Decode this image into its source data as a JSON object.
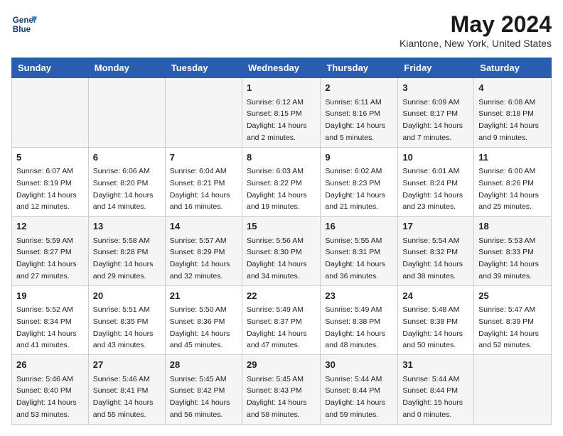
{
  "logo": {
    "line1": "General",
    "line2": "Blue"
  },
  "title": "May 2024",
  "location": "Kiantone, New York, United States",
  "days_header": [
    "Sunday",
    "Monday",
    "Tuesday",
    "Wednesday",
    "Thursday",
    "Friday",
    "Saturday"
  ],
  "weeks": [
    [
      {
        "day": "",
        "info": ""
      },
      {
        "day": "",
        "info": ""
      },
      {
        "day": "",
        "info": ""
      },
      {
        "day": "1",
        "info": "Sunrise: 6:12 AM\nSunset: 8:15 PM\nDaylight: 14 hours\nand 2 minutes."
      },
      {
        "day": "2",
        "info": "Sunrise: 6:11 AM\nSunset: 8:16 PM\nDaylight: 14 hours\nand 5 minutes."
      },
      {
        "day": "3",
        "info": "Sunrise: 6:09 AM\nSunset: 8:17 PM\nDaylight: 14 hours\nand 7 minutes."
      },
      {
        "day": "4",
        "info": "Sunrise: 6:08 AM\nSunset: 8:18 PM\nDaylight: 14 hours\nand 9 minutes."
      }
    ],
    [
      {
        "day": "5",
        "info": "Sunrise: 6:07 AM\nSunset: 8:19 PM\nDaylight: 14 hours\nand 12 minutes."
      },
      {
        "day": "6",
        "info": "Sunrise: 6:06 AM\nSunset: 8:20 PM\nDaylight: 14 hours\nand 14 minutes."
      },
      {
        "day": "7",
        "info": "Sunrise: 6:04 AM\nSunset: 8:21 PM\nDaylight: 14 hours\nand 16 minutes."
      },
      {
        "day": "8",
        "info": "Sunrise: 6:03 AM\nSunset: 8:22 PM\nDaylight: 14 hours\nand 19 minutes."
      },
      {
        "day": "9",
        "info": "Sunrise: 6:02 AM\nSunset: 8:23 PM\nDaylight: 14 hours\nand 21 minutes."
      },
      {
        "day": "10",
        "info": "Sunrise: 6:01 AM\nSunset: 8:24 PM\nDaylight: 14 hours\nand 23 minutes."
      },
      {
        "day": "11",
        "info": "Sunrise: 6:00 AM\nSunset: 8:26 PM\nDaylight: 14 hours\nand 25 minutes."
      }
    ],
    [
      {
        "day": "12",
        "info": "Sunrise: 5:59 AM\nSunset: 8:27 PM\nDaylight: 14 hours\nand 27 minutes."
      },
      {
        "day": "13",
        "info": "Sunrise: 5:58 AM\nSunset: 8:28 PM\nDaylight: 14 hours\nand 29 minutes."
      },
      {
        "day": "14",
        "info": "Sunrise: 5:57 AM\nSunset: 8:29 PM\nDaylight: 14 hours\nand 32 minutes."
      },
      {
        "day": "15",
        "info": "Sunrise: 5:56 AM\nSunset: 8:30 PM\nDaylight: 14 hours\nand 34 minutes."
      },
      {
        "day": "16",
        "info": "Sunrise: 5:55 AM\nSunset: 8:31 PM\nDaylight: 14 hours\nand 36 minutes."
      },
      {
        "day": "17",
        "info": "Sunrise: 5:54 AM\nSunset: 8:32 PM\nDaylight: 14 hours\nand 38 minutes."
      },
      {
        "day": "18",
        "info": "Sunrise: 5:53 AM\nSunset: 8:33 PM\nDaylight: 14 hours\nand 39 minutes."
      }
    ],
    [
      {
        "day": "19",
        "info": "Sunrise: 5:52 AM\nSunset: 8:34 PM\nDaylight: 14 hours\nand 41 minutes."
      },
      {
        "day": "20",
        "info": "Sunrise: 5:51 AM\nSunset: 8:35 PM\nDaylight: 14 hours\nand 43 minutes."
      },
      {
        "day": "21",
        "info": "Sunrise: 5:50 AM\nSunset: 8:36 PM\nDaylight: 14 hours\nand 45 minutes."
      },
      {
        "day": "22",
        "info": "Sunrise: 5:49 AM\nSunset: 8:37 PM\nDaylight: 14 hours\nand 47 minutes."
      },
      {
        "day": "23",
        "info": "Sunrise: 5:49 AM\nSunset: 8:38 PM\nDaylight: 14 hours\nand 48 minutes."
      },
      {
        "day": "24",
        "info": "Sunrise: 5:48 AM\nSunset: 8:38 PM\nDaylight: 14 hours\nand 50 minutes."
      },
      {
        "day": "25",
        "info": "Sunrise: 5:47 AM\nSunset: 8:39 PM\nDaylight: 14 hours\nand 52 minutes."
      }
    ],
    [
      {
        "day": "26",
        "info": "Sunrise: 5:46 AM\nSunset: 8:40 PM\nDaylight: 14 hours\nand 53 minutes."
      },
      {
        "day": "27",
        "info": "Sunrise: 5:46 AM\nSunset: 8:41 PM\nDaylight: 14 hours\nand 55 minutes."
      },
      {
        "day": "28",
        "info": "Sunrise: 5:45 AM\nSunset: 8:42 PM\nDaylight: 14 hours\nand 56 minutes."
      },
      {
        "day": "29",
        "info": "Sunrise: 5:45 AM\nSunset: 8:43 PM\nDaylight: 14 hours\nand 58 minutes."
      },
      {
        "day": "30",
        "info": "Sunrise: 5:44 AM\nSunset: 8:44 PM\nDaylight: 14 hours\nand 59 minutes."
      },
      {
        "day": "31",
        "info": "Sunrise: 5:44 AM\nSunset: 8:44 PM\nDaylight: 15 hours\nand 0 minutes."
      },
      {
        "day": "",
        "info": ""
      }
    ]
  ]
}
